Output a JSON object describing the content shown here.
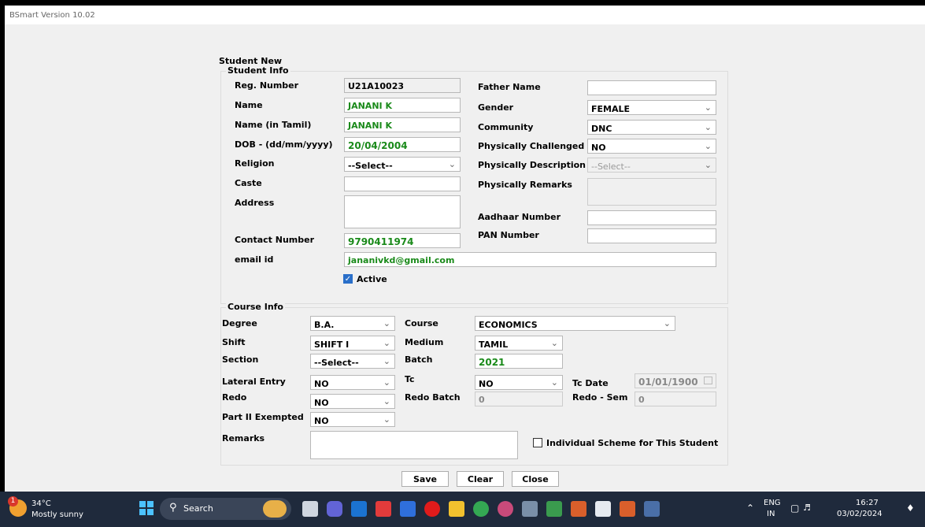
{
  "window": {
    "title": "BSmart Version 10.02"
  },
  "form": {
    "title": "Student New",
    "student_info": {
      "title": "Student Info",
      "reg_number": {
        "label": "Reg. Number",
        "value": "U21A10023"
      },
      "name": {
        "label": "Name",
        "value": "JANANI  K"
      },
      "name_tamil": {
        "label": "Name (in Tamil)",
        "value": "JANANI  K"
      },
      "dob": {
        "label": "DOB - (dd/mm/yyyy)",
        "value": "20/04/2004"
      },
      "religion": {
        "label": "Religion",
        "value": "--Select--"
      },
      "caste": {
        "label": "Caste",
        "value": ""
      },
      "address": {
        "label": "Address",
        "value": ""
      },
      "contact_number": {
        "label": "Contact Number",
        "value": "9790411974"
      },
      "email": {
        "label": "email id",
        "value": "jananivkd@gmail.com"
      },
      "father_name": {
        "label": "Father Name",
        "value": ""
      },
      "gender": {
        "label": "Gender",
        "value": "FEMALE"
      },
      "community": {
        "label": "Community",
        "value": "DNC"
      },
      "physically_challenged": {
        "label": "Physically Challenged",
        "value": "NO"
      },
      "physically_description": {
        "label": "Physically Description",
        "value": "--Select--"
      },
      "physically_remarks": {
        "label": "Physically Remarks",
        "value": ""
      },
      "aadhaar_number": {
        "label": "Aadhaar Number",
        "value": ""
      },
      "pan_number": {
        "label": "PAN Number",
        "value": ""
      },
      "active": {
        "label": "Active",
        "checked": true
      }
    },
    "course_info": {
      "title": "Course Info",
      "degree": {
        "label": "Degree",
        "value": "B.A."
      },
      "course": {
        "label": "Course",
        "value": "ECONOMICS"
      },
      "shift": {
        "label": "Shift",
        "value": "SHIFT I"
      },
      "medium": {
        "label": "Medium",
        "value": "TAMIL"
      },
      "section": {
        "label": "Section",
        "value": "--Select--"
      },
      "batch": {
        "label": "Batch",
        "value": "2021"
      },
      "lateral_entry": {
        "label": "Lateral Entry",
        "value": "NO"
      },
      "tc": {
        "label": "Tc",
        "value": "NO"
      },
      "tc_date": {
        "label": "Tc Date",
        "value": "01/01/1900"
      },
      "redo": {
        "label": "Redo",
        "value": "NO"
      },
      "redo_batch": {
        "label": "Redo Batch",
        "value": "0"
      },
      "redo_sem": {
        "label": "Redo - Sem",
        "value": "0"
      },
      "part2_exempted": {
        "label": "Part II Exempted",
        "value": "NO"
      },
      "remarks": {
        "label": "Remarks",
        "value": ""
      },
      "individual_scheme": {
        "label": "Individual Scheme for This Student",
        "checked": false
      }
    },
    "buttons": {
      "save": "Save",
      "clear": "Clear",
      "close": "Close"
    }
  },
  "taskbar": {
    "weather_temp": "34°C",
    "weather_desc": "Mostly sunny",
    "weather_badge": "1",
    "search_label": "Search",
    "lang_top": "ENG",
    "lang_bottom": "IN",
    "time": "16:27",
    "date": "03/02/2024"
  },
  "colors": {
    "green_text": "#1a8a1a",
    "taskbar_bg": "#1f2a3c",
    "checkbox_accent": "#2a6fc9"
  }
}
